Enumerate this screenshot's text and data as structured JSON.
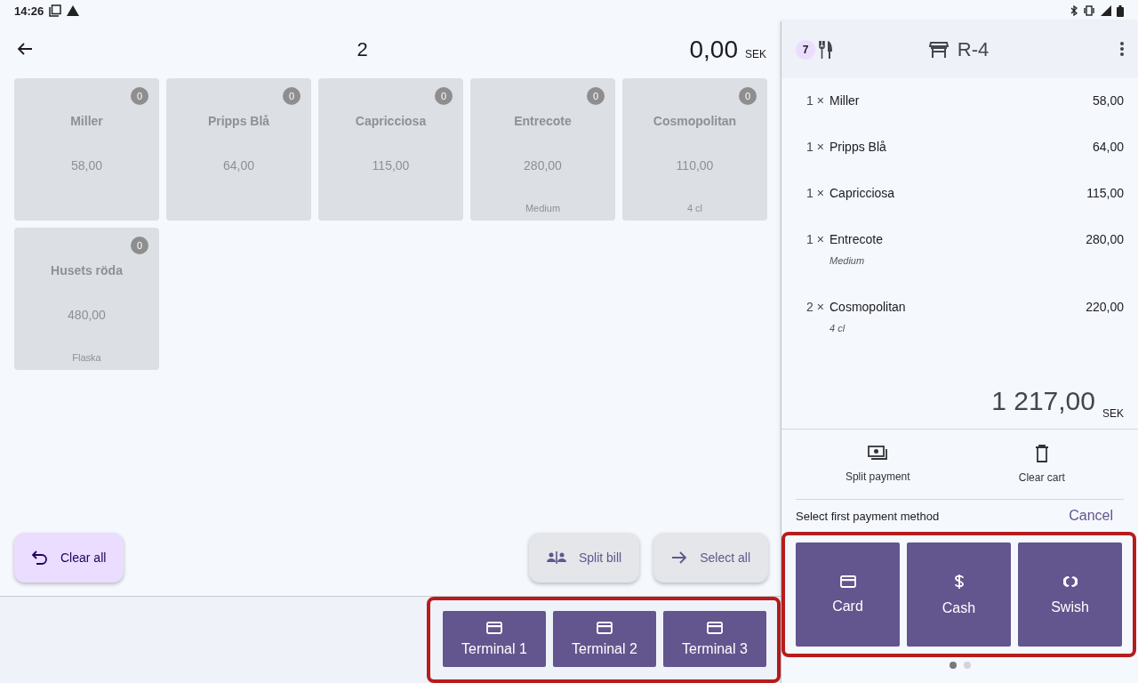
{
  "status_bar": {
    "time": "14:26"
  },
  "header": {
    "title": "2",
    "total": "0,00",
    "currency": "SEK"
  },
  "products": [
    {
      "name": "Miller",
      "price": "58,00",
      "count": "0"
    },
    {
      "name": "Pripps Blå",
      "price": "64,00",
      "count": "0"
    },
    {
      "name": "Capricciosa",
      "price": "115,00",
      "count": "0"
    },
    {
      "name": "Entrecote",
      "price": "280,00",
      "count": "0",
      "note": "Medium"
    },
    {
      "name": "Cosmopolitan",
      "price": "110,00",
      "count": "0",
      "note": "4 cl"
    },
    {
      "name": "Husets röda",
      "price": "480,00",
      "count": "0",
      "note": "Flaska"
    }
  ],
  "actions": [
    {
      "label": "Clear all",
      "kind": "clear"
    },
    {
      "label": "Split bill",
      "kind": "split"
    },
    {
      "label": "Select all",
      "kind": "select"
    }
  ],
  "terminals": [
    "Terminal 1",
    "Terminal 2",
    "Terminal 3"
  ],
  "order": {
    "guests": "7",
    "table": "R-4",
    "items": [
      {
        "qty": "1 ×",
        "name": "Miller",
        "price": "58,00"
      },
      {
        "qty": "1 ×",
        "name": "Pripps Blå",
        "price": "64,00"
      },
      {
        "qty": "1 ×",
        "name": "Capricciosa",
        "price": "115,00"
      },
      {
        "qty": "1 ×",
        "name": "Entrecote",
        "price": "280,00",
        "note": "Medium"
      },
      {
        "qty": "2 ×",
        "name": "Cosmopolitan",
        "price": "220,00",
        "note": "4 cl"
      }
    ],
    "total": "1 217,00",
    "currency": "SEK"
  },
  "tools": [
    {
      "label": "Split payment",
      "kind": "split"
    },
    {
      "label": "Clear cart",
      "kind": "clear"
    }
  ],
  "payment": {
    "prompt": "Select first payment method",
    "cancel": "Cancel",
    "methods": [
      {
        "label": "Card",
        "kind": "card"
      },
      {
        "label": "Cash",
        "kind": "cash"
      },
      {
        "label": "Swish",
        "kind": "swish"
      }
    ]
  },
  "pager": [
    {
      "selected": true
    },
    {
      "selected": false
    }
  ]
}
